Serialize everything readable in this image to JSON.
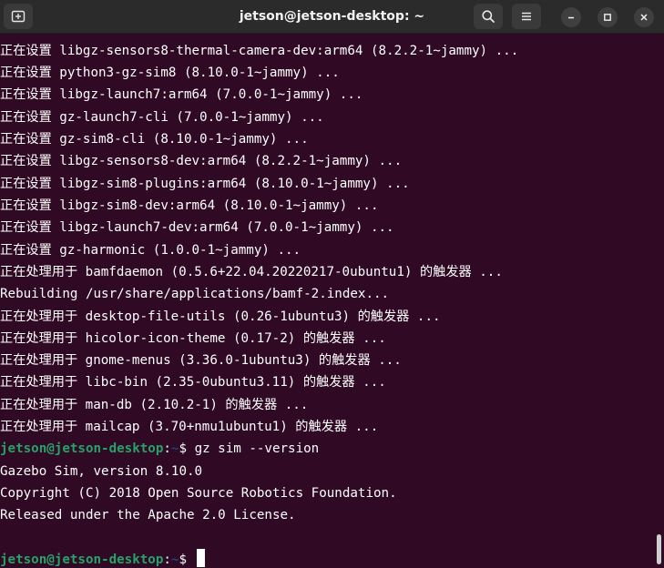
{
  "window": {
    "title": "jetson@jetson-desktop: ~"
  },
  "icons": {
    "new_tab": "new-tab-icon",
    "search": "search-icon",
    "menu": "hamburger-menu-icon",
    "minimize": "minimize-icon",
    "maximize": "maximize-icon",
    "close": "close-icon"
  },
  "colors": {
    "background": "#300a24",
    "prompt_user": "#26a269",
    "prompt_path": "#12488b",
    "text": "#ffffff"
  },
  "output_lines": [
    "正在设置 libgz-sensors8-thermal-camera-dev:arm64 (8.2.2-1~jammy) ...",
    "正在设置 python3-gz-sim8 (8.10.0-1~jammy) ...",
    "正在设置 libgz-launch7:arm64 (7.0.0-1~jammy) ...",
    "正在设置 gz-launch7-cli (7.0.0-1~jammy) ...",
    "正在设置 gz-sim8-cli (8.10.0-1~jammy) ...",
    "正在设置 libgz-sensors8-dev:arm64 (8.2.2-1~jammy) ...",
    "正在设置 libgz-sim8-plugins:arm64 (8.10.0-1~jammy) ...",
    "正在设置 libgz-sim8-dev:arm64 (8.10.0-1~jammy) ...",
    "正在设置 libgz-launch7-dev:arm64 (7.0.0-1~jammy) ...",
    "正在设置 gz-harmonic (1.0.0-1~jammy) ...",
    "正在处理用于 bamfdaemon (0.5.6+22.04.20220217-0ubuntu1) 的触发器 ...",
    "Rebuilding /usr/share/applications/bamf-2.index...",
    "正在处理用于 desktop-file-utils (0.26-1ubuntu3) 的触发器 ...",
    "正在处理用于 hicolor-icon-theme (0.17-2) 的触发器 ...",
    "正在处理用于 gnome-menus (3.36.0-1ubuntu3) 的触发器 ...",
    "正在处理用于 libc-bin (2.35-0ubuntu3.11) 的触发器 ...",
    "正在处理用于 man-db (2.10.2-1) 的触发器 ...",
    "正在处理用于 mailcap (3.70+nmu1ubuntu1) 的触发器 ..."
  ],
  "prompt": {
    "user_host": "jetson@jetson-desktop",
    "separator": ":",
    "path": "~",
    "symbol": "$"
  },
  "command": "gz sim --version",
  "command_output": [
    "Gazebo Sim, version 8.10.0",
    "Copyright (C) 2018 Open Source Robotics Foundation.",
    "Released under the Apache 2.0 License."
  ]
}
